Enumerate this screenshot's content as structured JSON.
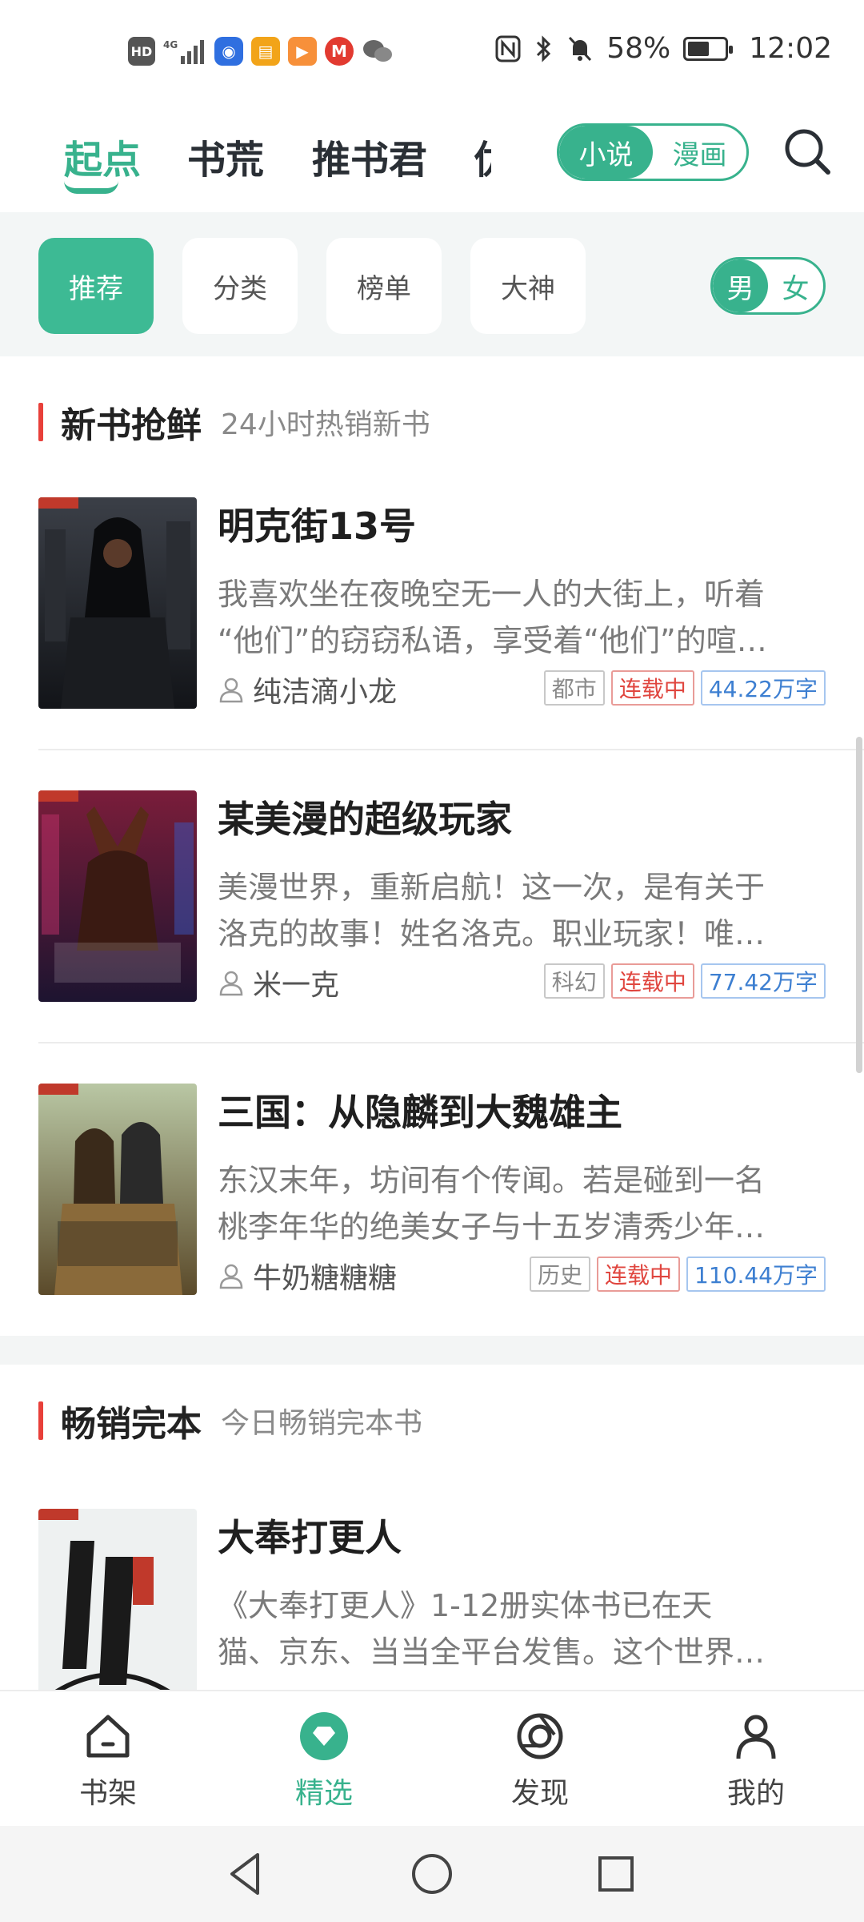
{
  "status_bar": {
    "left_icons": [
      "hd-icon",
      "4g-signal-icon",
      "app-icon-blue",
      "app-icon-orange",
      "app-icon-play",
      "metro-icon",
      "wechat-icon"
    ],
    "battery_percent": "58%",
    "battery_level": 0.58,
    "time": "12:02"
  },
  "top_nav": {
    "tabs": [
      "起点",
      "书荒",
      "推书君",
      "优"
    ],
    "active_tab": "起点",
    "toggle": {
      "on": "小说",
      "off": "漫画"
    }
  },
  "filters": {
    "chips": [
      "推荐",
      "分类",
      "榜单",
      "大神"
    ],
    "gender": {
      "on": "男",
      "off": "女"
    }
  },
  "sections": [
    {
      "title": "新书抢鲜",
      "subtitle": "24小时热销新书",
      "books": [
        {
          "title": "明克街13号",
          "desc_lines": [
            "我喜欢坐在夜晚空无一人的大街上，听着",
            "“他们”的窃窃私语，享受着“他们”的喧…"
          ],
          "author": "纯洁滴小龙",
          "category": "都市",
          "status": "连载中",
          "words": "44.22万字"
        },
        {
          "title": "某美漫的超级玩家",
          "desc_lines": [
            "美漫世界，重新启航！这一次，是有关于",
            "洛克的故事！姓名洛克。职业玩家！唯…"
          ],
          "author": "米一克",
          "category": "科幻",
          "status": "连载中",
          "words": "77.42万字"
        },
        {
          "title": "三国：从隐麟到大魏雄主",
          "desc_lines": [
            "东汉末年，坊间有个传闻。若是碰到一名",
            "桃李年华的绝美女子与十五岁清秀少年…"
          ],
          "author": "牛奶糖糖糖",
          "category": "历史",
          "status": "连载中",
          "words": "110.44万字"
        }
      ]
    },
    {
      "title": "畅销完本",
      "subtitle": "今日畅销完本书",
      "books": [
        {
          "title": "大奉打更人",
          "desc_lines": [
            "《大奉打更人》1-12册实体书已在天",
            "猫、京东、当当全平台发售。这个世界…"
          ],
          "author": "",
          "category": "",
          "status": "",
          "words": ""
        }
      ]
    }
  ],
  "bottom_nav": [
    {
      "label": "书架",
      "icon": "home-icon"
    },
    {
      "label": "精选",
      "icon": "featured-icon",
      "active": true
    },
    {
      "label": "发现",
      "icon": "discover-icon"
    },
    {
      "label": "我的",
      "icon": "profile-icon"
    }
  ],
  "colors": {
    "accent": "#38b28d",
    "section_bar": "#e8403a",
    "status_tag": "#e0463f",
    "words_tag": "#3d7fd1"
  }
}
